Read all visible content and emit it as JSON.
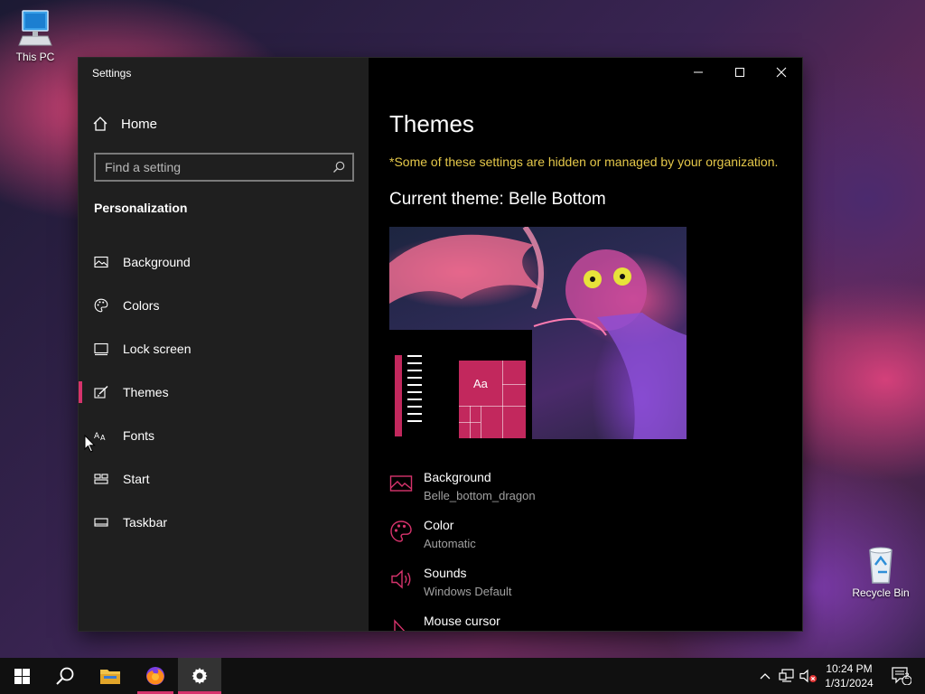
{
  "desktop": {
    "this_pc_label": "This PC",
    "recycle_bin_label": "Recycle Bin"
  },
  "window": {
    "title": "Settings"
  },
  "sidebar": {
    "home_label": "Home",
    "search_placeholder": "Find a setting",
    "section_title": "Personalization",
    "items": [
      {
        "label": "Background",
        "icon": "picture-icon",
        "active": false
      },
      {
        "label": "Colors",
        "icon": "palette-icon",
        "active": false
      },
      {
        "label": "Lock screen",
        "icon": "lock-screen-icon",
        "active": false
      },
      {
        "label": "Themes",
        "icon": "brush-icon",
        "active": true
      },
      {
        "label": "Fonts",
        "icon": "fonts-icon",
        "active": false
      },
      {
        "label": "Start",
        "icon": "start-icon",
        "active": false
      },
      {
        "label": "Taskbar",
        "icon": "taskbar-icon",
        "active": false
      }
    ]
  },
  "content": {
    "page_title": "Themes",
    "notice": "*Some of these settings are hidden or managed by your organization.",
    "current_theme_prefix": "Current theme:",
    "current_theme_name": "Belle Bottom",
    "preview_sample_text": "Aa",
    "settings": [
      {
        "label": "Background",
        "value": "Belle_bottom_dragon",
        "icon": "picture-icon"
      },
      {
        "label": "Color",
        "value": "Automatic",
        "icon": "palette-icon"
      },
      {
        "label": "Sounds",
        "value": "Windows Default",
        "icon": "speaker-icon"
      },
      {
        "label": "Mouse cursor",
        "value": "",
        "icon": "cursor-icon"
      }
    ]
  },
  "taskbar": {
    "time": "10:24 PM",
    "date": "1/31/2024",
    "notification_count": "2"
  },
  "colors": {
    "accent": "#d6336c",
    "notice": "#e5c84a",
    "sidebar_bg": "#1f1f1f",
    "content_bg": "#000000"
  }
}
